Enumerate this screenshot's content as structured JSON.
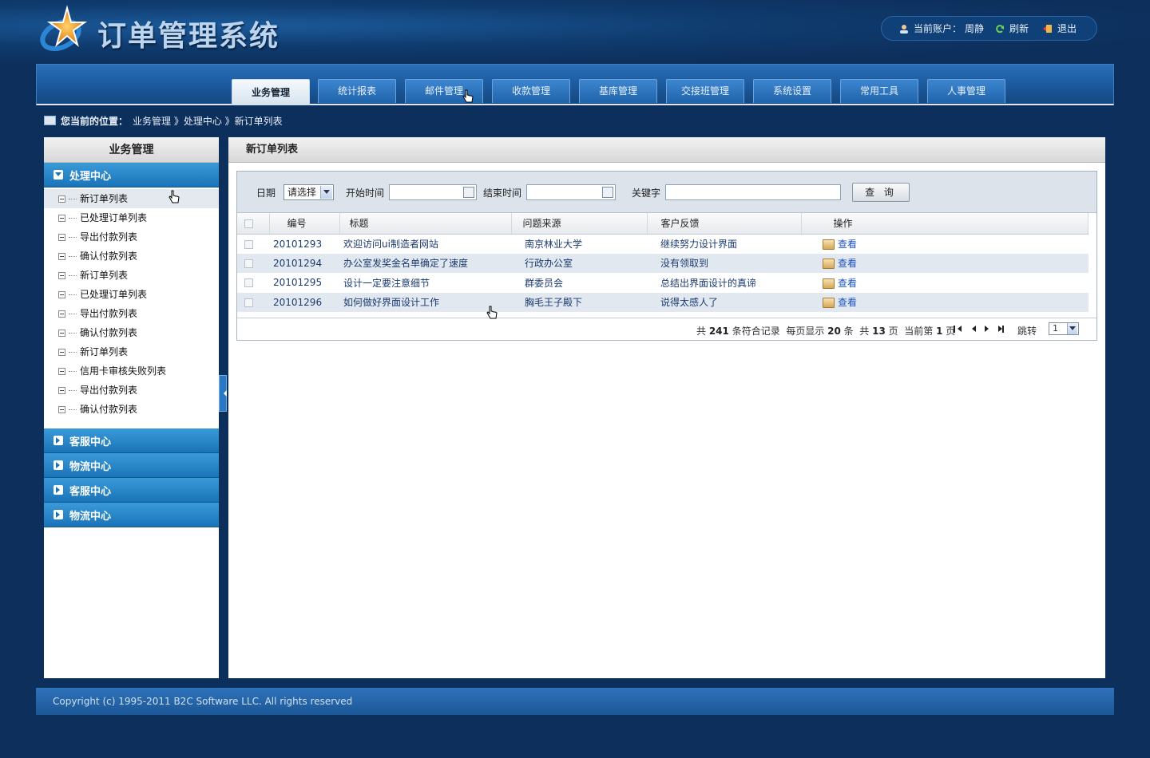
{
  "header": {
    "title": "订单管理系统",
    "account_label": "当前账户：",
    "account_name": "周静",
    "refresh_label": "刷新",
    "logout_label": "退出"
  },
  "nav": {
    "tabs": [
      {
        "label": "业务管理",
        "active": true
      },
      {
        "label": "统计报表"
      },
      {
        "label": "邮件管理"
      },
      {
        "label": "收款管理"
      },
      {
        "label": "基库管理"
      },
      {
        "label": "交接班管理"
      },
      {
        "label": "系统设置"
      },
      {
        "label": "常用工具"
      },
      {
        "label": "人事管理"
      }
    ]
  },
  "breadcrumb": {
    "prefix": "您当前的位置：",
    "path": "业务管理 》处理中心 》新订单列表"
  },
  "sidebar": {
    "title": "业务管理",
    "open_group": "处理中心",
    "items": [
      "新订单列表",
      "已处理订单列表",
      "导出付款列表",
      "确认付款列表",
      "新订单列表",
      "已处理订单列表",
      "导出付款列表",
      "确认付款列表",
      "新订单列表",
      "信用卡审核失败列表",
      "导出付款列表",
      "确认付款列表"
    ],
    "groups": [
      "客服中心",
      "物流中心",
      "客服中心",
      "物流中心"
    ]
  },
  "main": {
    "title": "新订单列表",
    "search": {
      "date_label": "日期",
      "date_select": "请选择",
      "start_label": "开始时间",
      "end_label": "结束时间",
      "keyword_label": "关键字",
      "query_button": "查 询"
    },
    "columns": [
      "编号",
      "标题",
      "问题来源",
      "客户反馈",
      "操作"
    ],
    "rows": [
      {
        "id": "20101293",
        "title": "欢迎访问ui制造者网站",
        "source": "南京林业大学",
        "feedback": "继续努力设计界面",
        "action": "查看"
      },
      {
        "id": "20101294",
        "title": "办公室发奖金名单确定了速度",
        "source": "行政办公室",
        "feedback": "没有领取到",
        "action": "查看"
      },
      {
        "id": "20101295",
        "title": "设计一定要注意细节",
        "source": "群委员会",
        "feedback": "总结出界面设计的真谛",
        "action": "查看"
      },
      {
        "id": "20101296",
        "title": "如何做好界面设计工作",
        "source": "胸毛王子殿下",
        "feedback": "说得太感人了",
        "action": "查看"
      }
    ],
    "pager": {
      "total_records": "241",
      "per_page": "20",
      "total_pages": "13",
      "current_page": "1",
      "jump_label": "跳转",
      "jump_value": "1"
    }
  },
  "footer": {
    "copyright": "Copyright (c) 1995-2011 B2C Software LLC. All rights reserved"
  },
  "colors": {
    "background": "#0d2f5c",
    "nav_blue": "#1a579a",
    "sidebar_group": "#1a74b8",
    "link": "#1a52c4"
  }
}
